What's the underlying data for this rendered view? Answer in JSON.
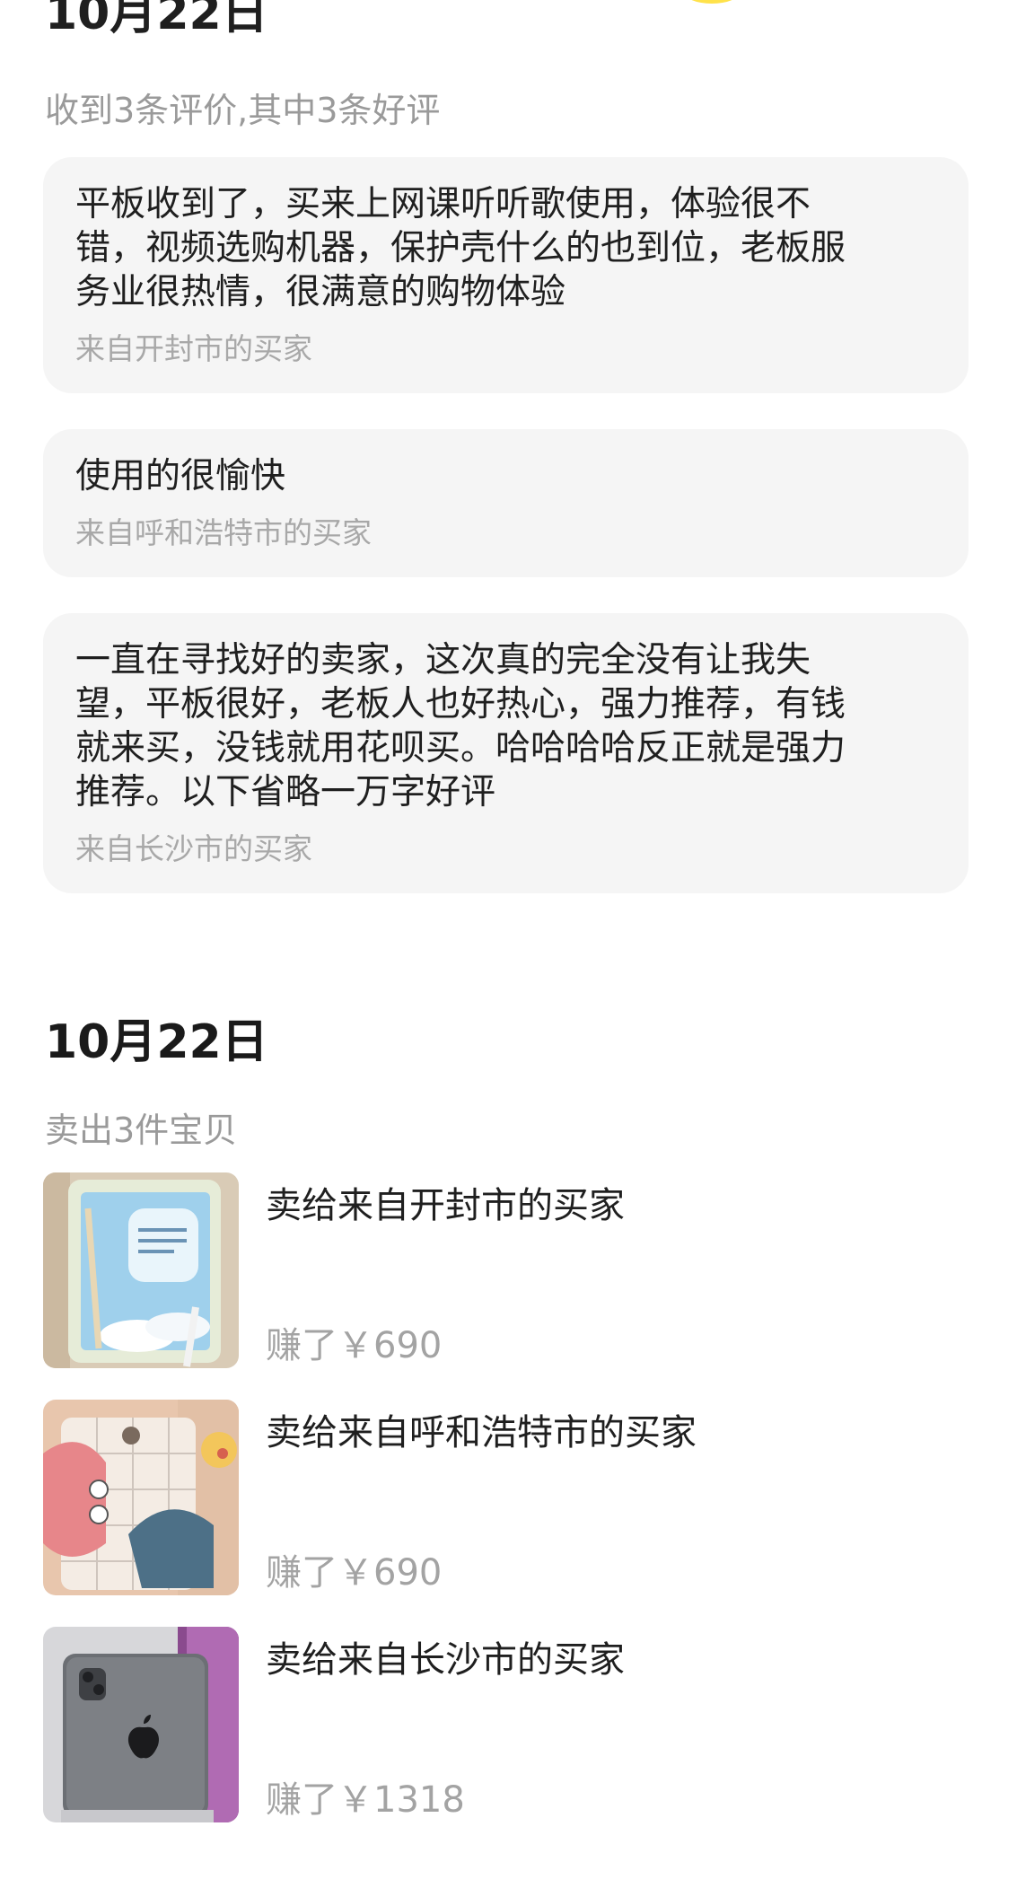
{
  "top_heading": "10月22日",
  "reviews_section": {
    "summary": "收到3条评价,其中3条好评",
    "reviews": [
      {
        "text": "平板收到了，买来上网课听听歌使用，体验很不\n错，视频选购机器，保护壳什么的也到位，老板服\n务业很热情，很满意的购物体验",
        "from": "来自开封市的买家"
      },
      {
        "text": "使用的很愉快",
        "from": "来自呼和浩特市的买家"
      },
      {
        "text": "一直在寻找好的卖家，这次真的完全没有让我失\n望，平板很好，老板人也好热心，强力推荐，有钱\n就来买，没钱就用花呗买。哈哈哈哈反正就是强力\n推荐。以下省略一万字好评",
        "from": "来自长沙市的买家"
      }
    ]
  },
  "sales_section": {
    "date": "10月22日",
    "summary": "卖出3件宝贝",
    "items": [
      {
        "title": "卖给来自开封市的买家",
        "earned": "赚了￥690",
        "thumb_icon": "tablet-photo-icon"
      },
      {
        "title": "卖给来自呼和浩特市的买家",
        "earned": "赚了￥690",
        "thumb_icon": "tablet-photo-icon"
      },
      {
        "title": "卖给来自长沙市的买家",
        "earned": "赚了￥1318",
        "thumb_icon": "ipad-pro-photo-icon"
      }
    ]
  },
  "colors": {
    "card_bg": "#f5f5f5",
    "muted_text": "#9a9a9a",
    "primary_text": "#1f1f1f",
    "accent_yellow": "#ffe24a"
  }
}
